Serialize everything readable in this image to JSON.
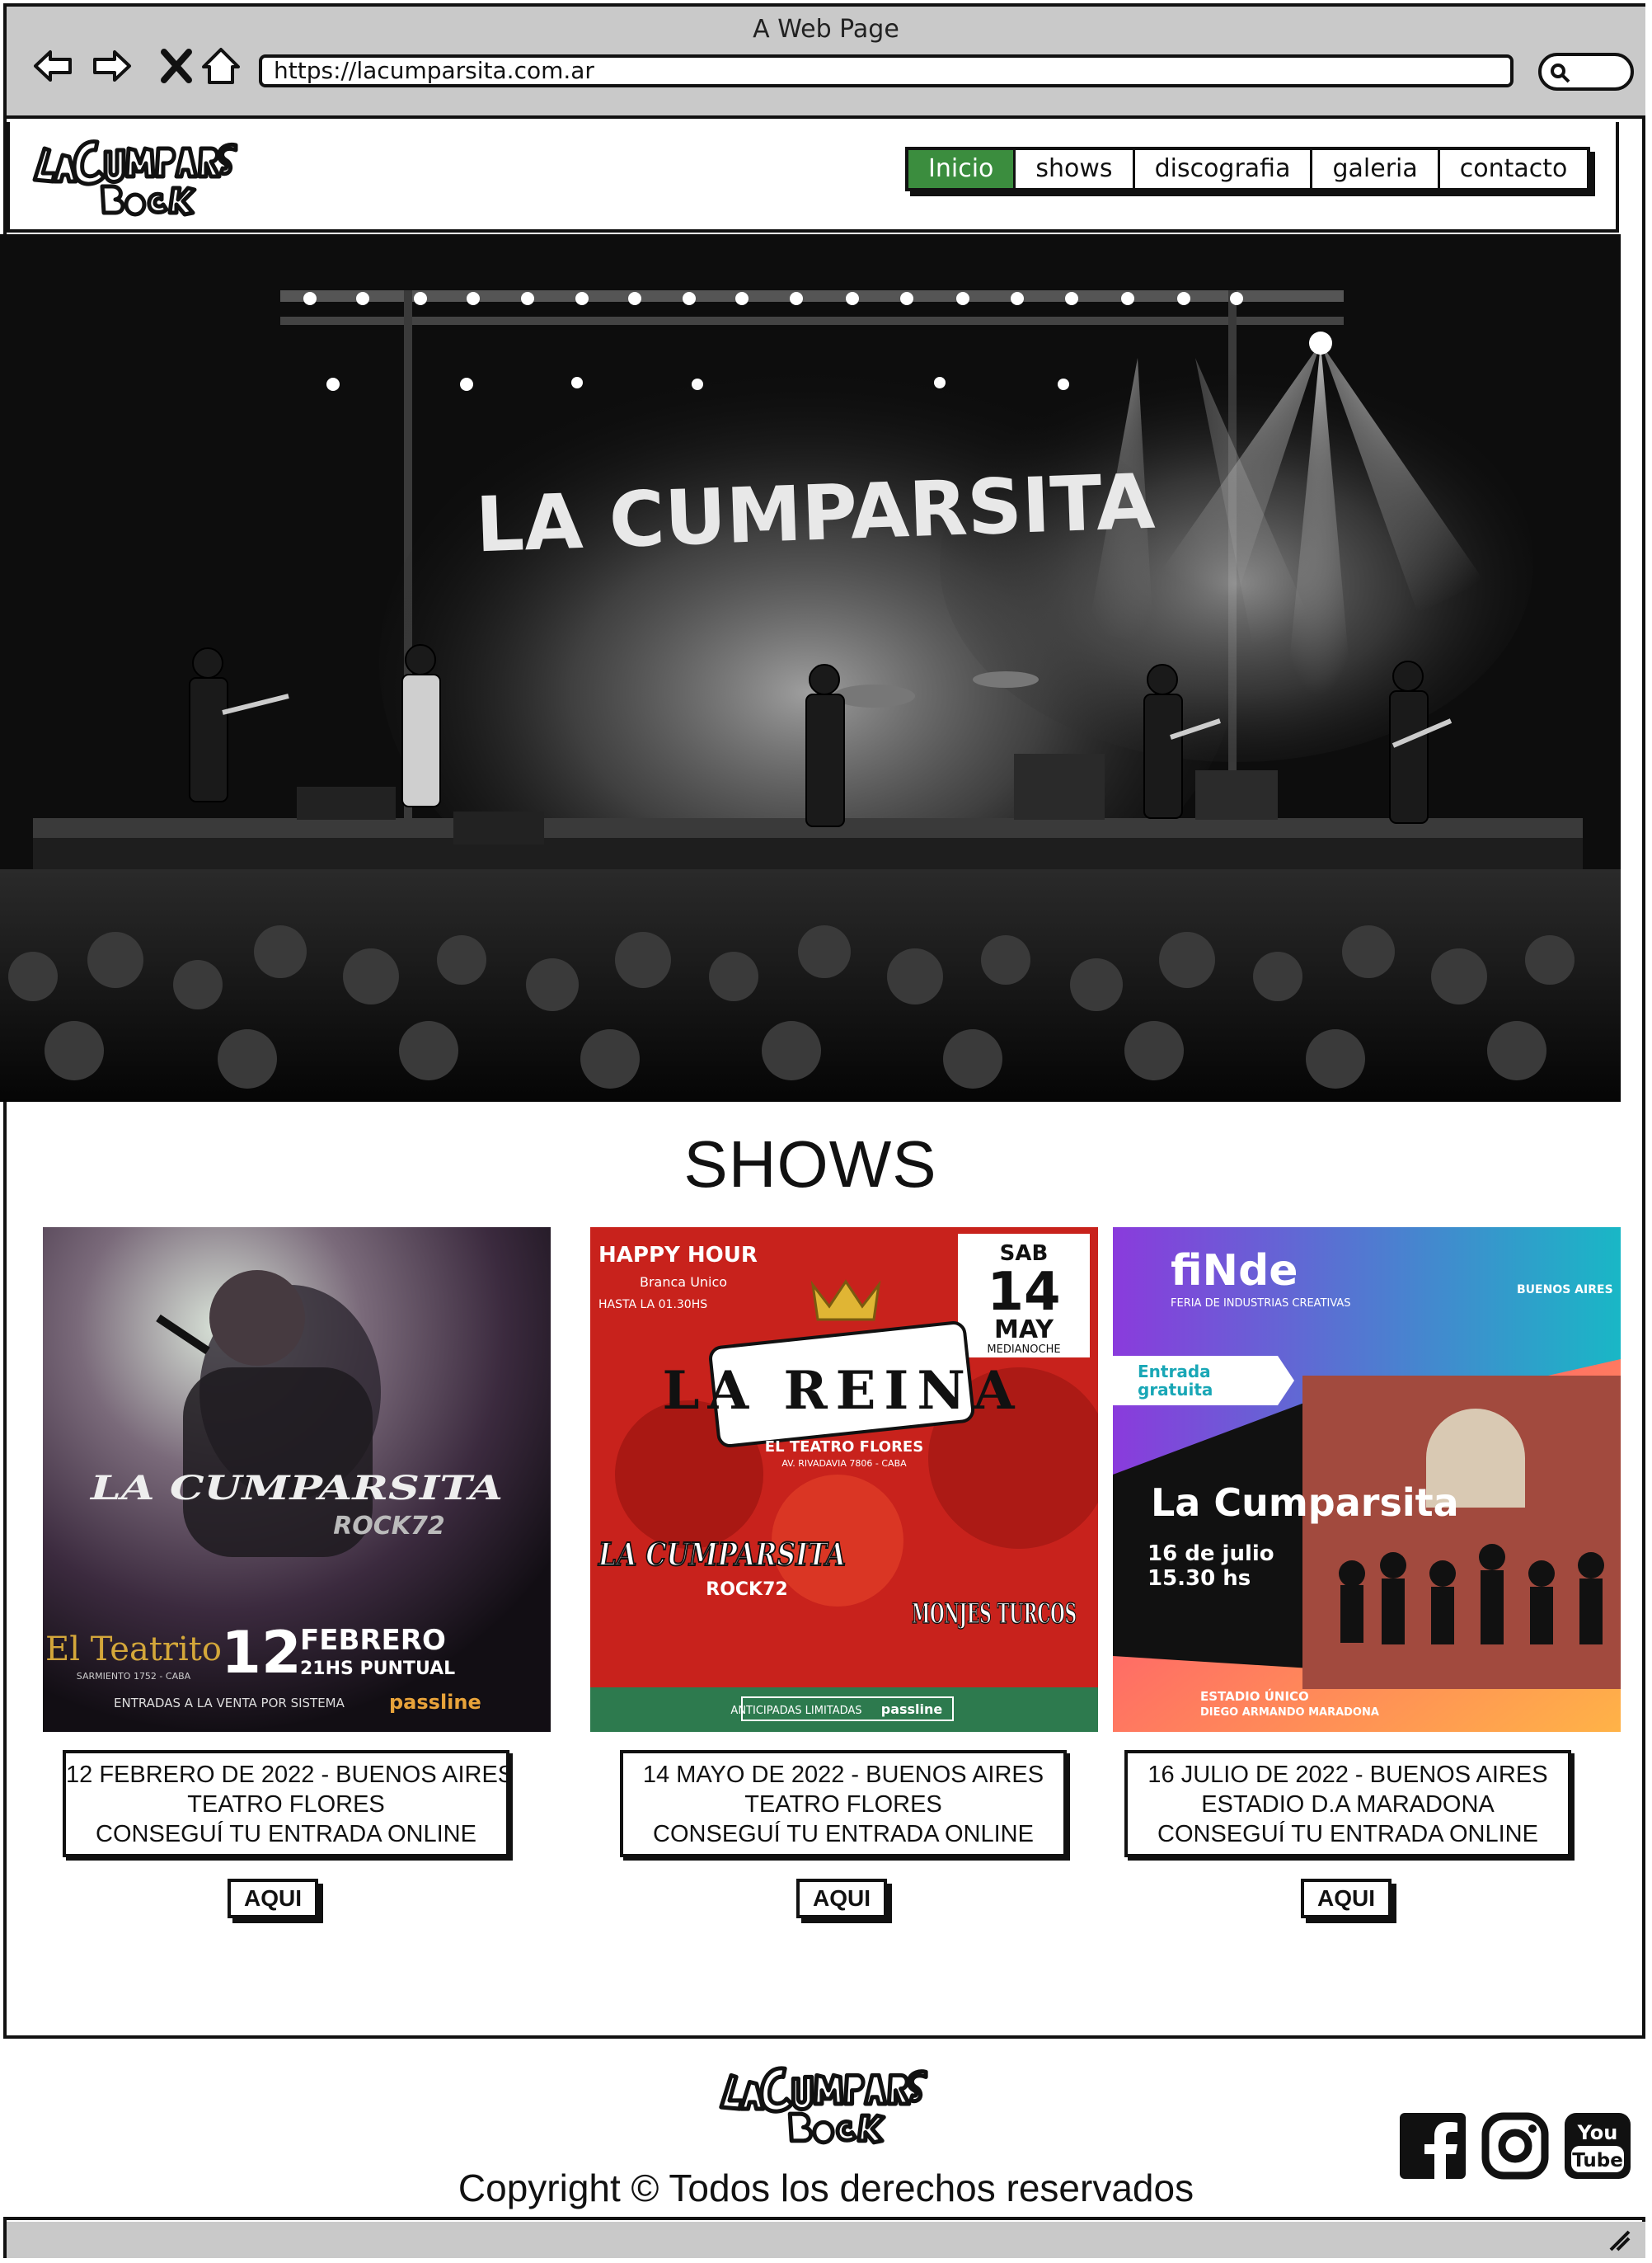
{
  "browser": {
    "window_title": "A Web Page",
    "url": "https://lacumparsita.com.ar",
    "icons": [
      "back-icon",
      "forward-icon",
      "close-icon",
      "home-icon",
      "search-icon"
    ]
  },
  "header": {
    "logo_text": "La Cumparsita Rock",
    "nav": [
      {
        "label": "Inicio",
        "active": true
      },
      {
        "label": "shows",
        "active": false
      },
      {
        "label": "discografia",
        "active": false
      },
      {
        "label": "galeria",
        "active": false
      },
      {
        "label": "contacto",
        "active": false
      }
    ]
  },
  "hero": {
    "stage_banner": "LA CUMPARSITA"
  },
  "shows": {
    "title": "SHOWS",
    "items": [
      {
        "poster": {
          "band": "LA CUMPARSITA",
          "sub": "ROCK72",
          "venue": "El Teatrito",
          "address": "SARMIENTO 1752 - CABA",
          "day": "12",
          "month": "FEBRERO",
          "time": "21HS PUNTUAL",
          "sales": "ENTRADAS A LA VENTA POR SISTEMA",
          "ticketer": "passline"
        },
        "line1": "12 FEBRERO DE 2022 - BUENOS AIRES",
        "line2": "TEATRO FLORES",
        "line3": "CONSEGUÍ TU ENTRADA ONLINE",
        "button": "AQUI"
      },
      {
        "poster": {
          "promo": "HAPPY HOUR",
          "promo_sub": "Branca Unico",
          "promo_time": "HASTA LA 01.30HS",
          "day_name": "SAB",
          "day": "14",
          "month": "MAY",
          "time": "MEDIANOCHE",
          "title": "LA REINA",
          "venue": "EL TEATRO FLORES",
          "address": "AV. RIVADAVIA 7806 - CABA",
          "band": "LA CUMPARSITA",
          "sub": "ROCK72",
          "guest": "MONJES TURCOS",
          "footer_notice": "ANTICIPADAS LIMITADAS",
          "ticketer": "passline"
        },
        "line1": "14 MAYO DE 2022 - BUENOS AIRES",
        "line2": "TEATRO FLORES",
        "line3": "CONSEGUÍ TU ENTRADA ONLINE",
        "button": "AQUI"
      },
      {
        "poster": {
          "event": "fiNde",
          "event_sub": "FERIA DE INDUSTRIAS CREATIVAS",
          "org": "BUENOS AIRES",
          "badge_line1": "Entrada",
          "badge_line2": "gratuita",
          "band": "La Cumparsita",
          "date": "16 de julio",
          "time": "15.30 hs",
          "venue_line1": "ESTADIO ÚNICO",
          "venue_line2": "DIEGO ARMANDO MARADONA"
        },
        "line1": "16 JULIO DE 2022 - BUENOS AIRES",
        "line2": "ESTADIO D.A MARADONA",
        "line3": "CONSEGUÍ TU ENTRADA ONLINE",
        "button": "AQUI"
      }
    ]
  },
  "footer": {
    "copyright": "Copyright © Todos los derechos reservados",
    "social": [
      "facebook-icon",
      "instagram-icon",
      "youtube-icon"
    ],
    "youtube_you": "You",
    "youtube_tube": "Tube"
  },
  "colors": {
    "nav_active": "#3b8d3e",
    "chrome": "#c9c9c9",
    "ink": "#111111"
  }
}
